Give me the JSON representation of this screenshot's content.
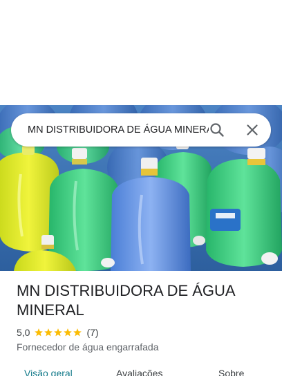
{
  "search": {
    "value": "MN DISTRIBUIDORA DE ÁGUA MINERAL",
    "search_icon": "search-icon",
    "close_icon": "close-icon"
  },
  "place": {
    "title": "MN DISTRIBUIDORA DE ÁGUA MINERAL",
    "rating": "5,0",
    "stars": 5,
    "review_count": "(7)",
    "category": "Fornecedor de água engarrafada"
  },
  "tabs": [
    {
      "label": "Visão geral",
      "active": true
    },
    {
      "label": "Avaliações",
      "active": false
    },
    {
      "label": "Sobre",
      "active": false
    }
  ],
  "colors": {
    "star": "#fbbc04",
    "active_tab": "#137a8a",
    "text": "#202124",
    "secondary_text": "#5f6368"
  }
}
